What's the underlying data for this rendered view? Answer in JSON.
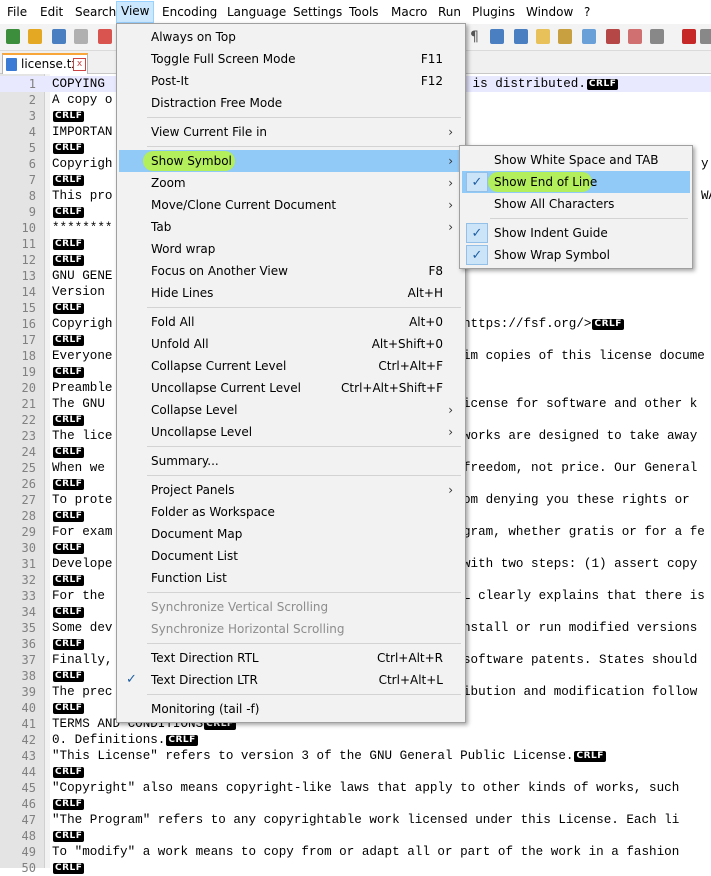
{
  "menubar": [
    "File",
    "Edit",
    "Search",
    "View",
    "Encoding",
    "Language",
    "Settings",
    "Tools",
    "Macro",
    "Run",
    "Plugins",
    "Window",
    "?"
  ],
  "tab": {
    "label": "license.txt",
    "close": "x"
  },
  "crlf": "CRLF",
  "editor_lines": [
    {
      "n": "1",
      "t": "COPYING",
      "tail": " is distributed.",
      "crlf": true
    },
    {
      "n": "2",
      "t": "A copy o",
      "crlf": false
    },
    {
      "n": "3",
      "t": "",
      "crlf": true
    },
    {
      "n": "4",
      "t": "IMPORTAN",
      "crlf": false
    },
    {
      "n": "5",
      "t": "",
      "crlf": true
    },
    {
      "n": "6",
      "t": "Copyrigh",
      "tail": "y r",
      "crlf": false
    },
    {
      "n": "7",
      "t": "",
      "crlf": true
    },
    {
      "n": "8",
      "t": "This pro",
      "tail": "WAR",
      "crlf": false
    },
    {
      "n": "9",
      "t": "",
      "crlf": true
    },
    {
      "n": "10",
      "t": "********",
      "crlf": false
    },
    {
      "n": "11",
      "t": "",
      "crlf": true
    },
    {
      "n": "12",
      "t": "",
      "crlf": true
    },
    {
      "n": "13",
      "t": "GNU GENE",
      "crlf": false
    },
    {
      "n": "14",
      "t": "Version",
      "crlf": false
    },
    {
      "n": "15",
      "t": "",
      "crlf": true
    },
    {
      "n": "16",
      "t": "Copyrigh",
      "tail": "https://fsf.org/>",
      "crlf": true
    },
    {
      "n": "17",
      "t": "",
      "crlf": true
    },
    {
      "n": "18",
      "t": "Everyone",
      "tail": "im copies of this license docume",
      "crlf": false
    },
    {
      "n": "19",
      "t": "",
      "crlf": true
    },
    {
      "n": "20",
      "t": "Preamble",
      "crlf": false
    },
    {
      "n": "21",
      "t": "The GNU",
      "tail": "icense for software and other k",
      "crlf": false
    },
    {
      "n": "22",
      "t": "",
      "crlf": true
    },
    {
      "n": "23",
      "t": "The lice",
      "tail": "works are designed to take away",
      "crlf": false
    },
    {
      "n": "24",
      "t": "",
      "crlf": true
    },
    {
      "n": "25",
      "t": "When we",
      "tail": "freedom, not price. Our General",
      "crlf": false
    },
    {
      "n": "26",
      "t": "",
      "crlf": true
    },
    {
      "n": "27",
      "t": "To prote",
      "tail": "om denying you these rights or",
      "crlf": false
    },
    {
      "n": "28",
      "t": "",
      "crlf": true
    },
    {
      "n": "29",
      "t": "For exam",
      "tail": "gram, whether gratis or for a fe",
      "crlf": false
    },
    {
      "n": "30",
      "t": "",
      "crlf": true
    },
    {
      "n": "31",
      "t": "Develope",
      "tail": "with two steps: (1) assert copy",
      "crlf": false
    },
    {
      "n": "32",
      "t": "",
      "crlf": true
    },
    {
      "n": "33",
      "t": "For the",
      "tail": "L clearly explains that there is",
      "crlf": false
    },
    {
      "n": "34",
      "t": "",
      "crlf": true
    },
    {
      "n": "35",
      "t": "Some dev",
      "tail": "nstall or run modified versions",
      "crlf": false
    },
    {
      "n": "36",
      "t": "",
      "crlf": true
    },
    {
      "n": "37",
      "t": "Finally,",
      "tail": "software patents. States should",
      "crlf": false
    },
    {
      "n": "38",
      "t": "",
      "crlf": true
    },
    {
      "n": "39",
      "t": "The prec",
      "tail": "ibution and modification follow",
      "crlf": false
    },
    {
      "n": "40",
      "t": "",
      "crlf": true
    },
    {
      "n": "41",
      "t": "TERMS AND CONDITIONS",
      "crlf": true
    },
    {
      "n": "42",
      "t": "0. Definitions.",
      "crlf": true
    },
    {
      "n": "43",
      "t": "\"This License\" refers to version 3 of the GNU General Public License.",
      "crlf": true
    },
    {
      "n": "44",
      "t": "",
      "crlf": true
    },
    {
      "n": "45",
      "t": "\"Copyright\" also means copyright-like laws that apply to other kinds of works, such",
      "crlf": false
    },
    {
      "n": "46",
      "t": "",
      "crlf": true
    },
    {
      "n": "47",
      "t": "\"The Program\" refers to any copyrightable work licensed under this License. Each li",
      "crlf": false
    },
    {
      "n": "48",
      "t": "",
      "crlf": true
    },
    {
      "n": "49",
      "t": "To \"modify\" a work means to copy from or adapt all or part of the work in a fashion",
      "crlf": false
    },
    {
      "n": "50",
      "t": "",
      "crlf": true
    }
  ],
  "view_menu": [
    {
      "label": "Always on Top",
      "shortcut": "",
      "arrow": false
    },
    {
      "label": "Toggle Full Screen Mode",
      "shortcut": "F11",
      "arrow": false
    },
    {
      "label": "Post-It",
      "shortcut": "F12",
      "arrow": false
    },
    {
      "label": "Distraction Free Mode",
      "shortcut": "",
      "arrow": false
    },
    {
      "sep": true
    },
    {
      "label": "View Current File in",
      "shortcut": "",
      "arrow": true
    },
    {
      "sep": true
    },
    {
      "label": "Show Symbol",
      "shortcut": "",
      "arrow": true,
      "highlight": true
    },
    {
      "label": "Zoom",
      "shortcut": "",
      "arrow": true
    },
    {
      "label": "Move/Clone Current Document",
      "shortcut": "",
      "arrow": true
    },
    {
      "label": "Tab",
      "shortcut": "",
      "arrow": true
    },
    {
      "label": "Word wrap",
      "shortcut": "",
      "arrow": false
    },
    {
      "label": "Focus on Another View",
      "shortcut": "F8",
      "arrow": false
    },
    {
      "label": "Hide Lines",
      "shortcut": "Alt+H",
      "arrow": false
    },
    {
      "sep": true
    },
    {
      "label": "Fold All",
      "shortcut": "Alt+0",
      "arrow": false
    },
    {
      "label": "Unfold All",
      "shortcut": "Alt+Shift+0",
      "arrow": false
    },
    {
      "label": "Collapse Current Level",
      "shortcut": "Ctrl+Alt+F",
      "arrow": false
    },
    {
      "label": "Uncollapse Current Level",
      "shortcut": "Ctrl+Alt+Shift+F",
      "arrow": false
    },
    {
      "label": "Collapse Level",
      "shortcut": "",
      "arrow": true
    },
    {
      "label": "Uncollapse Level",
      "shortcut": "",
      "arrow": true
    },
    {
      "sep": true
    },
    {
      "label": "Summary...",
      "shortcut": "",
      "arrow": false
    },
    {
      "sep": true
    },
    {
      "label": "Project Panels",
      "shortcut": "",
      "arrow": true
    },
    {
      "label": "Folder as Workspace",
      "shortcut": "",
      "arrow": false
    },
    {
      "label": "Document Map",
      "shortcut": "",
      "arrow": false
    },
    {
      "label": "Document List",
      "shortcut": "",
      "arrow": false
    },
    {
      "label": "Function List",
      "shortcut": "",
      "arrow": false
    },
    {
      "sep": true
    },
    {
      "label": "Synchronize Vertical Scrolling",
      "shortcut": "",
      "arrow": false,
      "disabled": true
    },
    {
      "label": "Synchronize Horizontal Scrolling",
      "shortcut": "",
      "arrow": false,
      "disabled": true
    },
    {
      "sep": true
    },
    {
      "label": "Text Direction RTL",
      "shortcut": "Ctrl+Alt+R",
      "arrow": false
    },
    {
      "label": "Text Direction LTR",
      "shortcut": "Ctrl+Alt+L",
      "arrow": false,
      "checked": true
    },
    {
      "sep": true
    },
    {
      "label": "Monitoring (tail -f)",
      "shortcut": "",
      "arrow": false
    }
  ],
  "show_symbol_submenu": [
    {
      "label": "Show White Space and TAB",
      "checked": false
    },
    {
      "label": "Show End of Line",
      "checked": true,
      "highlight": true
    },
    {
      "label": "Show All Characters",
      "checked": false
    },
    {
      "sep": true
    },
    {
      "label": "Show Indent Guide",
      "checked": true
    },
    {
      "label": "Show Wrap Symbol",
      "checked": true
    }
  ],
  "colors": {
    "menu_highlight": "#91c9f7",
    "marker": "#b9f542",
    "accent": "#1f5fa3"
  }
}
